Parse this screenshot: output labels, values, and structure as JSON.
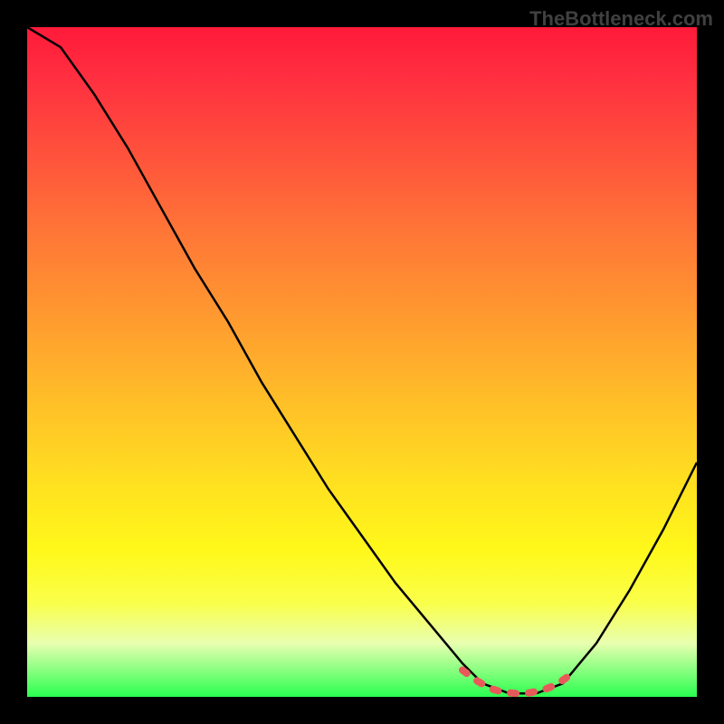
{
  "watermark": "TheBottleneck.com",
  "chart_data": {
    "type": "line",
    "title": "",
    "xlabel": "",
    "ylabel": "",
    "xlim": [
      0,
      100
    ],
    "ylim": [
      0,
      100
    ],
    "gradient_stops": [
      {
        "pos": 0,
        "color": "#ff1a3a"
      },
      {
        "pos": 8,
        "color": "#ff3040"
      },
      {
        "pos": 20,
        "color": "#ff553b"
      },
      {
        "pos": 32,
        "color": "#ff7a36"
      },
      {
        "pos": 44,
        "color": "#ff9c2f"
      },
      {
        "pos": 56,
        "color": "#ffbf28"
      },
      {
        "pos": 68,
        "color": "#ffe020"
      },
      {
        "pos": 78,
        "color": "#fff81a"
      },
      {
        "pos": 86,
        "color": "#faff4a"
      },
      {
        "pos": 92,
        "color": "#e8ffb0"
      },
      {
        "pos": 100,
        "color": "#2aff50"
      }
    ],
    "series": [
      {
        "name": "bottleneck-curve",
        "color": "#000000",
        "x": [
          0,
          5,
          10,
          15,
          20,
          25,
          30,
          35,
          40,
          45,
          50,
          55,
          60,
          65,
          68,
          72,
          76,
          80,
          85,
          90,
          95,
          100
        ],
        "y": [
          100,
          97,
          90,
          82,
          73,
          64,
          56,
          47,
          39,
          31,
          24,
          17,
          11,
          5,
          2,
          0.5,
          0.5,
          2,
          8,
          16,
          25,
          35
        ]
      },
      {
        "name": "valley-highlight",
        "color": "#e85a5a",
        "x": [
          65,
          67,
          69,
          71,
          73,
          75,
          77,
          79,
          81
        ],
        "y": [
          4,
          2.5,
          1.3,
          0.7,
          0.5,
          0.6,
          1.0,
          1.8,
          3.2
        ]
      }
    ]
  }
}
